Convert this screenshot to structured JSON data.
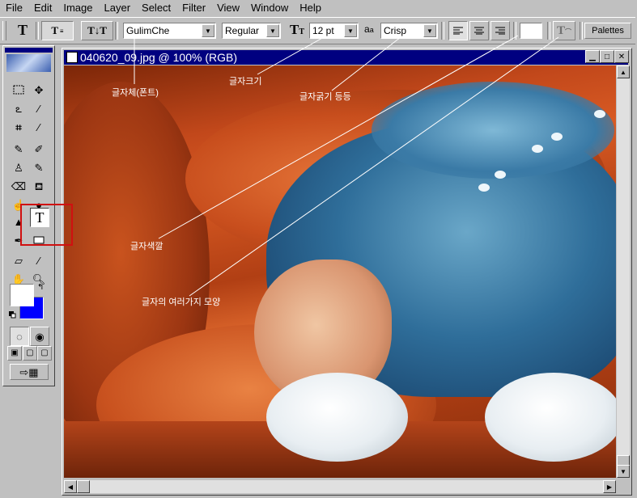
{
  "menu": [
    "File",
    "Edit",
    "Image",
    "Layer",
    "Select",
    "Filter",
    "View",
    "Window",
    "Help"
  ],
  "options_bar": {
    "font_family": "GulimChe",
    "font_style": "Regular",
    "font_size": "12 pt",
    "antialias_label": "a",
    "antialias_sublabel": "a",
    "antialias": "Crisp",
    "palettes_button": "Palettes"
  },
  "document": {
    "title": "040620_09.jpg @ 100% (RGB)"
  },
  "annotations": {
    "font": "글자체(폰트)",
    "size": "글자크기",
    "weight": "글자굵기 등등",
    "color": "글자색깔",
    "warp": "글자의 여러가지 모양"
  },
  "colors": {
    "title_bar": "#000080",
    "foreground_swatch": "#ffffff",
    "background_swatch": "#0000ff",
    "highlight_box": "#d01010"
  }
}
